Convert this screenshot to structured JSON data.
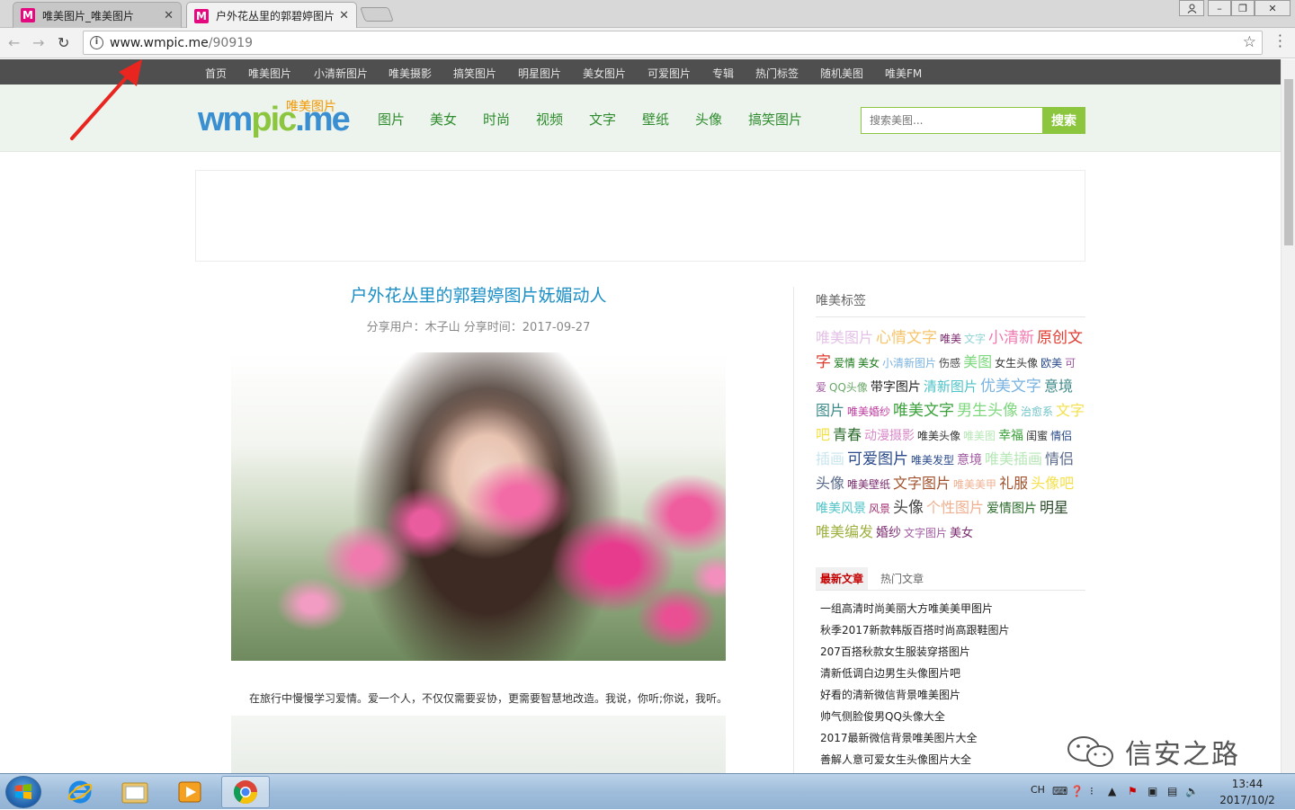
{
  "browser": {
    "tabs": [
      {
        "favicon": "M",
        "title": "唯美图片_唯美图片",
        "active": false
      },
      {
        "favicon": "M",
        "title": "户外花丛里的郭碧婷图片",
        "active": true
      }
    ],
    "url_host": "www.wmpic.me",
    "url_path": "/90919"
  },
  "topnav": [
    "首页",
    "唯美图片",
    "小清新图片",
    "唯美摄影",
    "搞笑图片",
    "明星图片",
    "美女图片",
    "可爱图片",
    "专辑",
    "热门标签",
    "随机美图",
    "唯美FM"
  ],
  "header": {
    "logo_text": "wmpic.me",
    "logo_cn": "唯美图片",
    "categories": [
      "图片",
      "美女",
      "时尚",
      "视频",
      "文字",
      "壁纸",
      "头像",
      "搞笑图片"
    ],
    "search_placeholder": "搜索美图...",
    "search_button": "搜索"
  },
  "article": {
    "title": "户外花丛里的郭碧婷图片妩媚动人",
    "meta": "分享用户：木子山    分享时间：2017-09-27",
    "caption": "在旅行中慢慢学习爱情。爱一个人，不仅仅需要妥协，更需要智慧地改造。我说，你听;你说，我听。"
  },
  "sidebar": {
    "tags_title": "唯美标签",
    "tags": [
      {
        "t": "唯美图片",
        "c": "#e3c1e6",
        "s": 16
      },
      {
        "t": "心情文字",
        "c": "#f5c46b",
        "s": 17
      },
      {
        "t": "唯美",
        "c": "#7a2a6e",
        "s": 12
      },
      {
        "t": "文字",
        "c": "#8fd3d6",
        "s": 12
      },
      {
        "t": "小清新",
        "c": "#f07ab0",
        "s": 17
      },
      {
        "t": "原创文字",
        "c": "#e03a2e",
        "s": 17
      },
      {
        "t": "爱情",
        "c": "#1b7a1b",
        "s": 12
      },
      {
        "t": "美女",
        "c": "#1b7a1b",
        "s": 12
      },
      {
        "t": "小清新图片",
        "c": "#7bb3e0",
        "s": 12
      },
      {
        "t": "伤感",
        "c": "#444",
        "s": 12
      },
      {
        "t": "美图",
        "c": "#7dd87d",
        "s": 16
      },
      {
        "t": "女生头像",
        "c": "#333",
        "s": 12
      },
      {
        "t": "欧美",
        "c": "#2a4a8a",
        "s": 12
      },
      {
        "t": "可爱",
        "c": "#a05aa0",
        "s": 12
      },
      {
        "t": "QQ头像",
        "c": "#6aa86a",
        "s": 12
      },
      {
        "t": "带字图片",
        "c": "#222",
        "s": 14
      },
      {
        "t": "清新图片",
        "c": "#4fc3c8",
        "s": 15
      },
      {
        "t": "优美文字",
        "c": "#7bb3e0",
        "s": 17
      },
      {
        "t": "意境图片",
        "c": "#3f8a8a",
        "s": 16
      },
      {
        "t": "唯美婚纱",
        "c": "#c03aa0",
        "s": 12
      },
      {
        "t": "唯美文字",
        "c": "#3aa03a",
        "s": 17
      },
      {
        "t": "男生头像",
        "c": "#7ed87e",
        "s": 17
      },
      {
        "t": "治愈系",
        "c": "#6fc3c8",
        "s": 12
      },
      {
        "t": "文字吧",
        "c": "#f5e04a",
        "s": 16
      },
      {
        "t": "青春",
        "c": "#2a6a2a",
        "s": 16
      },
      {
        "t": "动漫摄影",
        "c": "#d88ac8",
        "s": 14
      },
      {
        "t": "唯美头像",
        "c": "#333",
        "s": 12
      },
      {
        "t": "唯美图",
        "c": "#b6e7b6",
        "s": 12
      },
      {
        "t": "幸福",
        "c": "#3aa03a",
        "s": 14
      },
      {
        "t": "闺蜜",
        "c": "#333",
        "s": 12
      },
      {
        "t": "情侣",
        "c": "#2a4a8a",
        "s": 12
      },
      {
        "t": "插画",
        "c": "#c9e6f0",
        "s": 16
      },
      {
        "t": "可爱图片",
        "c": "#2a4a8a",
        "s": 17
      },
      {
        "t": "唯美发型",
        "c": "#2a4a8a",
        "s": 12
      },
      {
        "t": "意境",
        "c": "#a05aa0",
        "s": 14
      },
      {
        "t": "唯美插画",
        "c": "#b6e7b6",
        "s": 16
      },
      {
        "t": "情侣头像",
        "c": "#5a6a8a",
        "s": 16
      },
      {
        "t": "唯美壁纸",
        "c": "#7a2a6e",
        "s": 12
      },
      {
        "t": "文字图片",
        "c": "#a0522d",
        "s": 16
      },
      {
        "t": "唯美美甲",
        "c": "#f0b090",
        "s": 12
      },
      {
        "t": "礼服",
        "c": "#a0522d",
        "s": 16
      },
      {
        "t": "头像吧",
        "c": "#f5e04a",
        "s": 16
      },
      {
        "t": "唯美风景",
        "c": "#4fc3c8",
        "s": 14
      },
      {
        "t": "风景",
        "c": "#a0306e",
        "s": 12
      },
      {
        "t": "头像",
        "c": "#444",
        "s": 17
      },
      {
        "t": "个性图片",
        "c": "#f0b090",
        "s": 16
      },
      {
        "t": "爱情图片",
        "c": "#2a6a2a",
        "s": 14
      },
      {
        "t": "明星",
        "c": "#2a4a2a",
        "s": 16
      },
      {
        "t": "唯美编发",
        "c": "#a0b040",
        "s": 16
      },
      {
        "t": "婚纱",
        "c": "#7a2a6e",
        "s": 14
      },
      {
        "t": "文字图片",
        "c": "#a05aa0",
        "s": 12
      },
      {
        "t": "美女",
        "c": "#7a2a6e",
        "s": 13
      }
    ],
    "tab_latest": "最新文章",
    "tab_hot": "热门文章",
    "articles": [
      "一组高清时尚美丽大方唯美美甲图片",
      "秋季2017新款韩版百搭时尚高跟鞋图片",
      "207百搭秋款女生服装穿搭图片",
      "清新低调白边男生头像图片吧",
      "好看的清新微信背景唯美图片",
      "帅气侧脸俊男QQ头像大全",
      "2017最新微信背景唯美图片大全",
      "善解人意可爱女生头像图片大全"
    ]
  },
  "watermark": "信安之路",
  "taskbar": {
    "lang": "CH",
    "time": "13:44",
    "date": "2017/10/2"
  }
}
